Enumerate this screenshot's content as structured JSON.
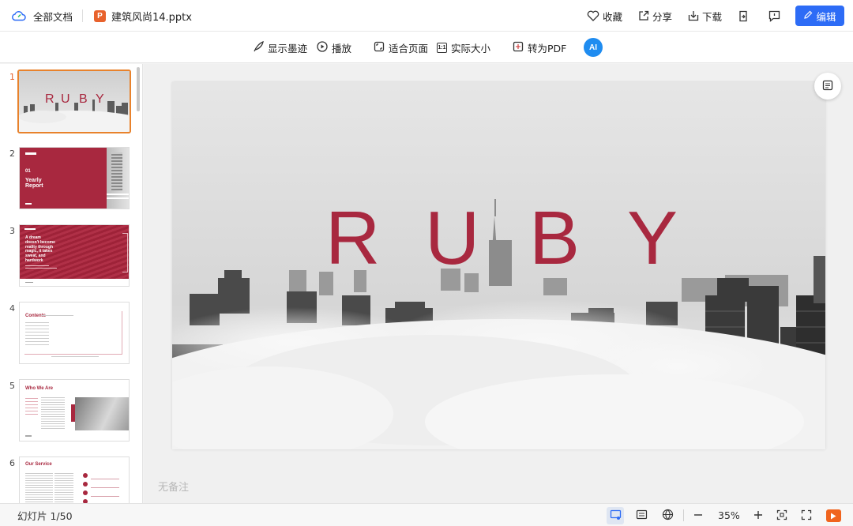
{
  "topbar": {
    "all_docs_label": "全部文档",
    "file_badge": "P",
    "file_name": "建筑风尚14.pptx",
    "favorite_label": "收藏",
    "share_label": "分享",
    "download_label": "下载",
    "edit_label": "编辑"
  },
  "toolbar": {
    "ink_label": "显示墨迹",
    "play_label": "播放",
    "fit_label": "适合页面",
    "actual_size_label": "实际大小",
    "actual_size_icon_text": "1:1",
    "to_pdf_label": "转为PDF",
    "ai_label": "AI"
  },
  "slide": {
    "title_letters": [
      "R",
      "U",
      "B",
      "Y"
    ],
    "accent_color": "#a8283f"
  },
  "thumbnails": {
    "numbers": [
      "1",
      "2",
      "3",
      "4",
      "5",
      "6"
    ],
    "t2": {
      "num": "01",
      "title_line1": "Yearly",
      "title_line2": "Report"
    },
    "t3": {
      "lines": [
        "A dream",
        "doesn't become",
        "reality through",
        "magic, it takes",
        "sweat, and",
        "hardwork"
      ]
    },
    "t4": {
      "title": "Contents"
    },
    "t5": {
      "title": "Who We Are"
    },
    "t6": {
      "title": "Our Service"
    }
  },
  "notes": {
    "placeholder": "无备注"
  },
  "statusbar": {
    "slide_counter": "幻灯片 1/50",
    "zoom": "35%"
  },
  "icons": {
    "cloud": "cloud-icon",
    "heart": "heart-icon",
    "share": "share-icon",
    "download": "download-icon",
    "pencil": "pencil-icon"
  }
}
